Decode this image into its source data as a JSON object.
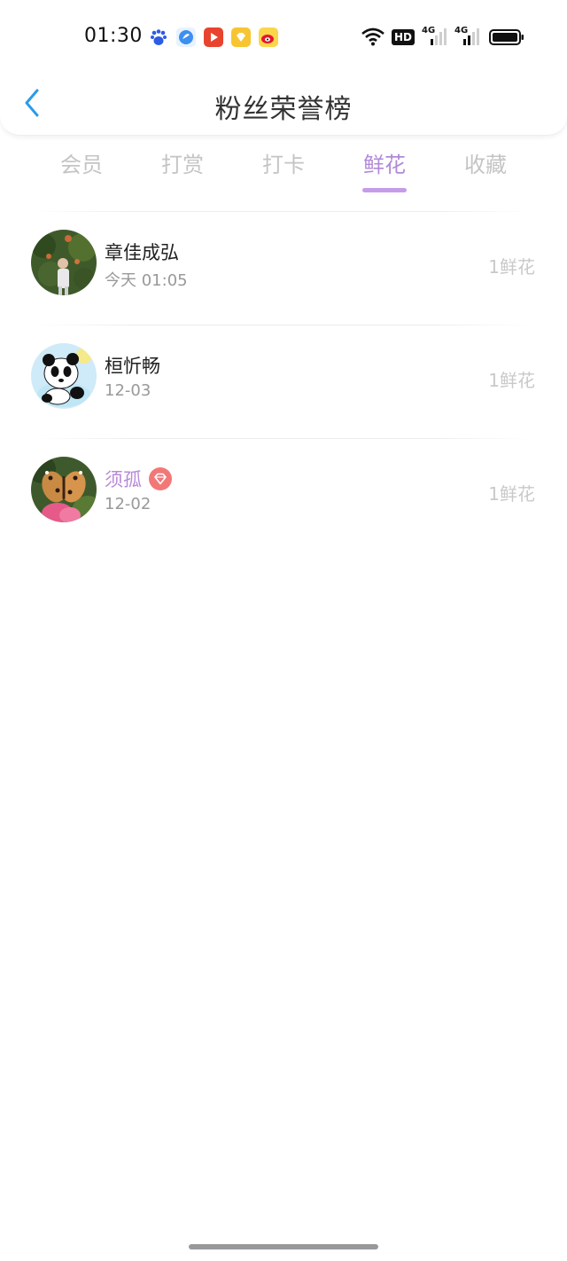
{
  "status_bar": {
    "time": "01:30",
    "app_icons": [
      "baidu-paw-icon",
      "blue-bird-icon",
      "video-play-icon",
      "yellow-diamond-icon",
      "weibo-icon"
    ],
    "hd_label": "HD",
    "network_1": "4G",
    "network_2": "4G"
  },
  "nav": {
    "title": "粉丝荣誉榜"
  },
  "tabs": [
    {
      "label": "会员"
    },
    {
      "label": "打赏"
    },
    {
      "label": "打卡"
    },
    {
      "label": "鲜花"
    },
    {
      "label": "收藏"
    }
  ],
  "active_tab": "鲜花",
  "list": [
    {
      "name": "章佳成弘",
      "date": "今天 01:05",
      "count": "1鲜花",
      "vip": false
    },
    {
      "name": "桓忻畅",
      "date": "12-03",
      "count": "1鲜花",
      "vip": false
    },
    {
      "name": "须孤",
      "date": "12-02",
      "count": "1鲜花",
      "vip": true
    }
  ],
  "colors": {
    "accent": "#b08ad8",
    "back_arrow": "#2b9be8",
    "vip_badge": "#f27878"
  }
}
